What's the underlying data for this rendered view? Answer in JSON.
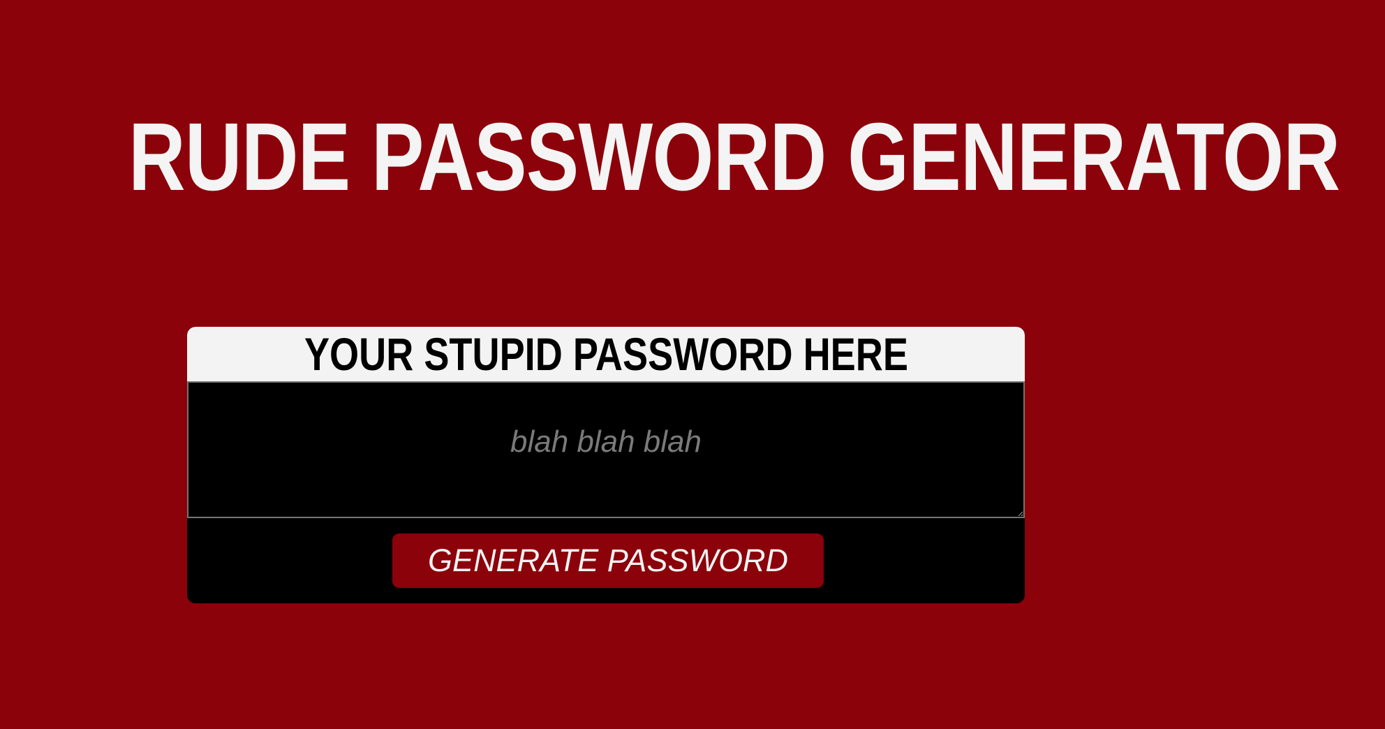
{
  "page": {
    "title": "RUDE PASSWORD GENERATOR",
    "background_color": "#8b020a"
  },
  "card": {
    "header": "YOUR STUPID PASSWORD HERE",
    "password_field": {
      "value": "",
      "placeholder": "blah blah blah"
    },
    "generate_button_label": "GENERATE PASSWORD"
  },
  "colors": {
    "accent": "#8b020a",
    "card_background": "#000000",
    "header_background": "#f3f3f3",
    "title_text": "#f4f4f4"
  }
}
